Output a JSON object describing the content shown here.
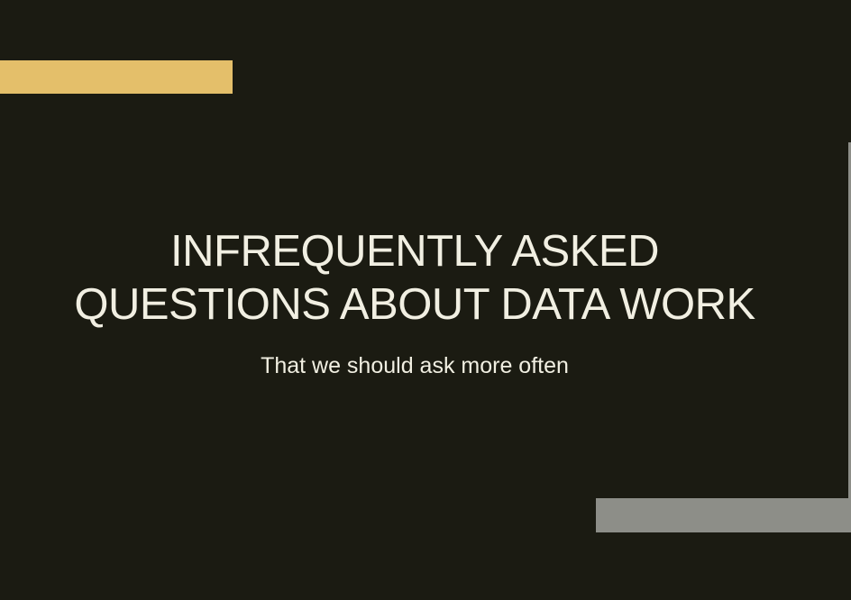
{
  "slide": {
    "title_lines": [
      "INFREQUENTLY ASKED",
      "QUESTIONS ABOUT DATA WORK"
    ],
    "subtitle": "That we should ask more often"
  },
  "colors": {
    "background": "#1b1b12",
    "text": "#f1efe2",
    "accent_gold": "#e4bf6a",
    "accent_gray": "#8d8e88",
    "edge_line": "#8d8e88"
  }
}
